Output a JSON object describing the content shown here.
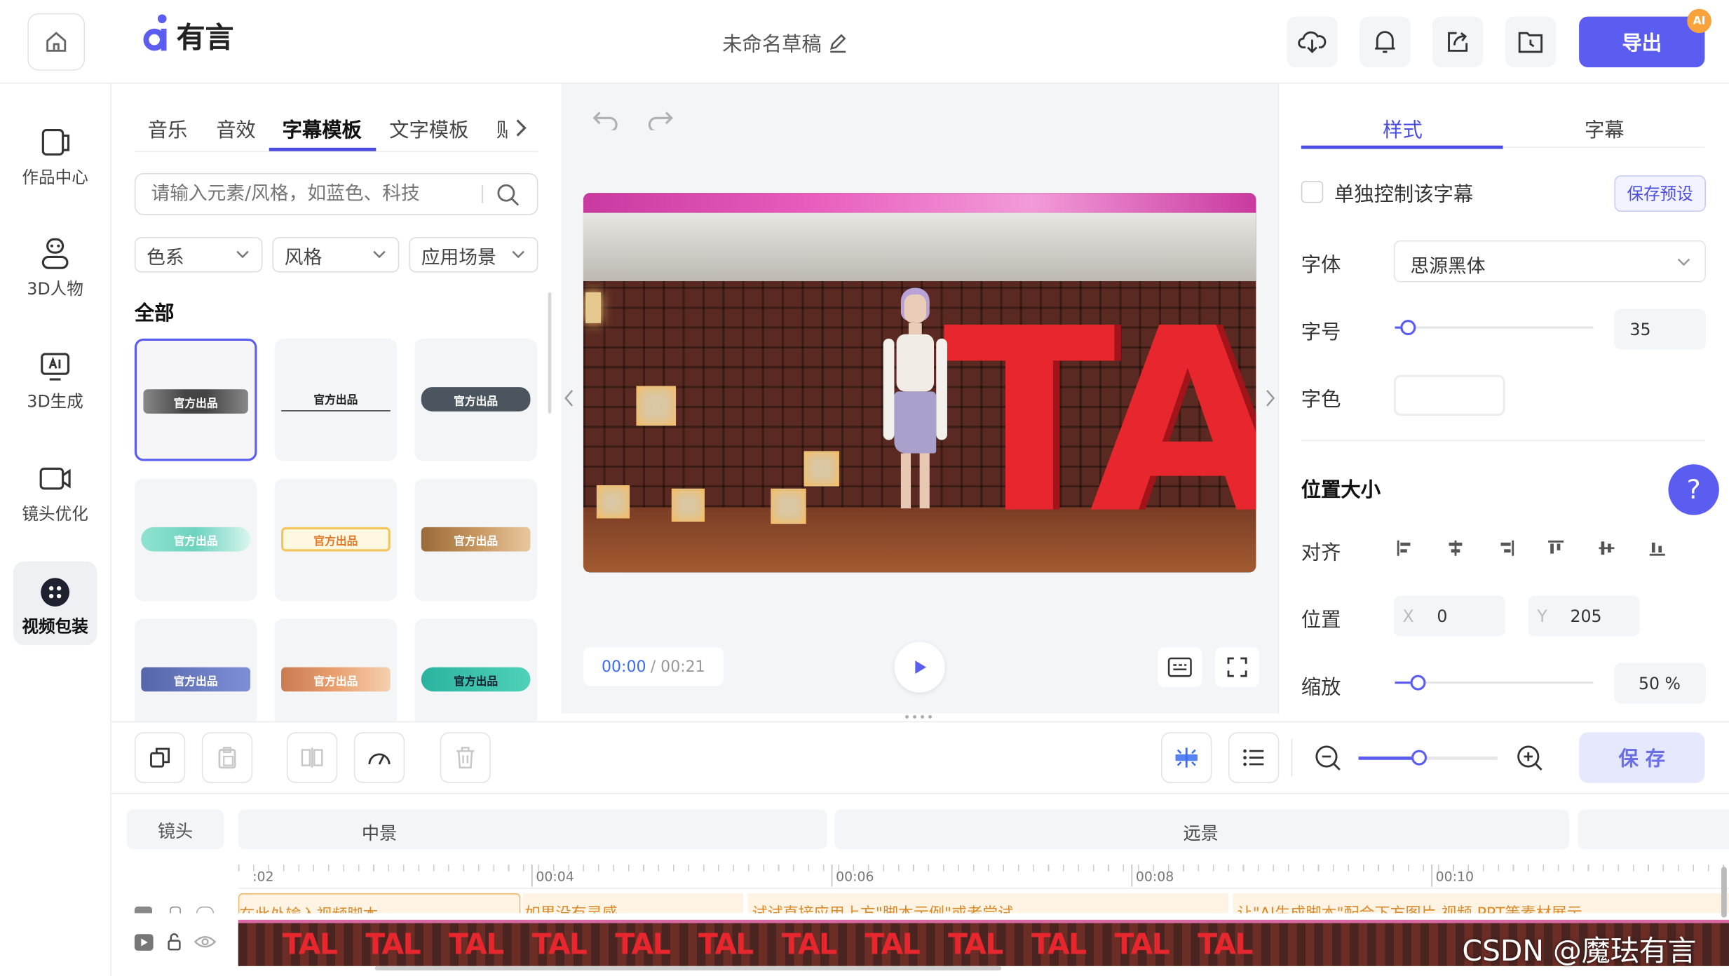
{
  "app": {
    "logo_text": "有言",
    "draft_title": "未命名草稿"
  },
  "header": {
    "export_label": "导出",
    "ai_badge": "AI"
  },
  "left_nav": [
    {
      "label": "作品中心",
      "icon": "works-icon"
    },
    {
      "label": "3D人物",
      "icon": "person-icon"
    },
    {
      "label": "3D生成",
      "icon": "ai-generate-icon"
    },
    {
      "label": "镜头优化",
      "icon": "camera-icon"
    },
    {
      "label": "视频包装",
      "icon": "package-icon"
    }
  ],
  "asset_panel": {
    "tabs": [
      "音乐",
      "音效",
      "字幕模板",
      "文字模板",
      "贴"
    ],
    "active_tab": "字幕模板",
    "search_placeholder": "请输入元素/风格，如蓝色、科技",
    "filters": [
      "色系",
      "风格",
      "应用场景"
    ],
    "section_title": "全部",
    "templates": [
      {
        "label": "官方出品"
      },
      {
        "label": "官方出品"
      },
      {
        "label": "官方出品"
      },
      {
        "label": "官方出品"
      },
      {
        "label": "官方出品"
      },
      {
        "label": "官方出品"
      },
      {
        "label": "官方出品"
      },
      {
        "label": "官方出品"
      },
      {
        "label": "官方出品"
      }
    ]
  },
  "preview": {
    "sign_text": "TAL",
    "time_current": "00:00",
    "time_total": "/ 00:21"
  },
  "properties": {
    "tabs": [
      "样式",
      "字幕"
    ],
    "active_tab": "样式",
    "single_control_label": "单独控制该字幕",
    "save_preset_label": "保存预设",
    "font_label": "字体",
    "font_value": "思源黑体",
    "size_label": "字号",
    "size_value": "35",
    "color_label": "字色",
    "section_title": "位置大小",
    "align_label": "对齐",
    "position_label": "位置",
    "x_label": "X",
    "x_value": "0",
    "y_label": "Y",
    "y_value": "205",
    "scale_label": "缩放",
    "scale_value": "50 %",
    "help": "?"
  },
  "toolbar": {
    "save_label": "保 存"
  },
  "timeline": {
    "track_label": "镜头",
    "shots": [
      "中景",
      "远景"
    ],
    "ruler": [
      ":02",
      "00:04",
      "00:06",
      "00:08",
      "00:10"
    ],
    "subtitles": [
      "在此处输入视频脚本",
      "如果没有灵感",
      "试试直接应用上方\"脚本示例\"或者尝试",
      "让\"AI生成脚本\"配合下方图片 视频 PPT等素材展示"
    ],
    "clip_text": "TAL"
  },
  "watermark": "CSDN @魔珐有言",
  "colors": {
    "accent": "#5b5cf0",
    "tab_active": "#4a4de0",
    "time_blue": "#3b6df0"
  }
}
